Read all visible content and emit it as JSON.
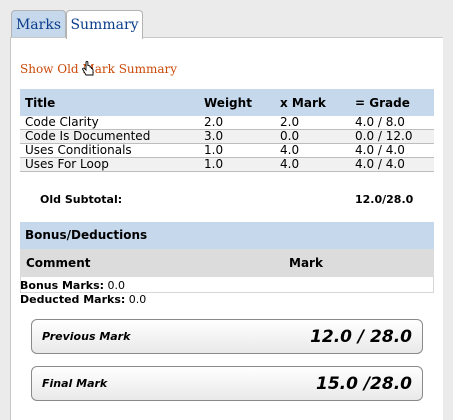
{
  "tabs": [
    {
      "label": "Marks"
    },
    {
      "label": "Summary"
    }
  ],
  "show_old_link": "Show Old Mark Summary",
  "marks_table": {
    "headers": [
      "Title",
      "Weight",
      "x Mark",
      "= Grade"
    ],
    "rows": [
      [
        "Code Clarity",
        "2.0",
        "2.0",
        "4.0 / 8.0"
      ],
      [
        "Code Is Documented",
        "3.0",
        "0.0",
        "0.0 / 12.0"
      ],
      [
        "Uses Conditionals",
        "1.0",
        "4.0",
        "4.0 / 4.0"
      ],
      [
        "Uses For Loop",
        "1.0",
        "4.0",
        "4.0 / 4.0"
      ]
    ]
  },
  "old_subtotal": {
    "label": "Old Subtotal:",
    "value": "12.0/28.0"
  },
  "bonus": {
    "heading": "Bonus/Deductions",
    "col_comment": "Comment",
    "col_mark": "Mark",
    "bonus_label": "Bonus Marks:",
    "bonus_value": "0.0",
    "deducted_label": "Deducted Marks:",
    "deducted_value": "0.0"
  },
  "previous_mark": {
    "label": "Previous Mark",
    "value": "12.0 / 28.0"
  },
  "final_mark": {
    "label": "Final Mark",
    "value": "15.0 /28.0"
  },
  "colors": {
    "accent_blue": "#c6d8ec",
    "link_orange": "#cc4a0a",
    "tab_text": "#0b3d8c"
  },
  "icons": {
    "cursor": "hand-pointer-icon"
  }
}
